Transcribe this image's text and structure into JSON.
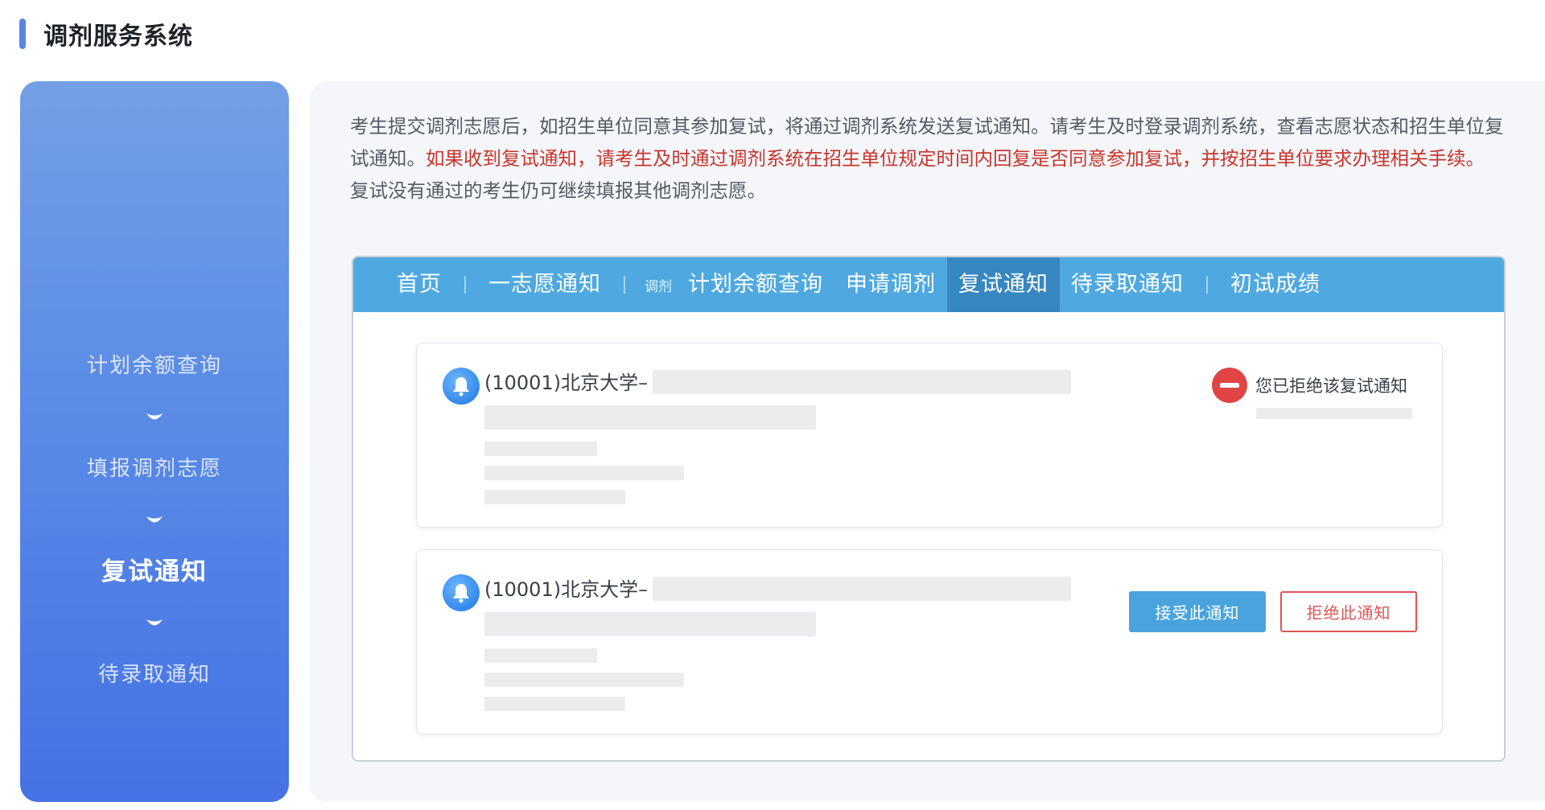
{
  "header": {
    "title": "调剂服务系统"
  },
  "sidebar": {
    "steps": [
      {
        "label": "计划余额查询",
        "active": false
      },
      {
        "label": "填报调剂志愿",
        "active": false
      },
      {
        "label": "复试通知",
        "active": true
      },
      {
        "label": "待录取通知",
        "active": false
      }
    ]
  },
  "intro": {
    "line1": "考生提交调剂志愿后，如招生单位同意其参加复试，将通过调剂系统发送复试通知。请考生及时登录调剂系统，查看志愿状态和招生单位复试通知。",
    "highlight": "如果收到复试通知，请考生及时通过调剂系统在招生单位规定时间内回复是否同意参加复试，并按招生单位要求办理相关手续。",
    "line2": "复试没有通过的考生仍可继续填报其他调剂志愿。"
  },
  "screenshot": {
    "nav": {
      "home": "首页",
      "first_choice": "一志愿通知",
      "adjust_small": "调剂",
      "quota": "计划余额查询",
      "apply": "申请调剂",
      "retest": "复试通知",
      "pending": "待录取通知",
      "scores": "初试成绩",
      "active": "复试通知"
    },
    "cards": [
      {
        "school": "(10001)北京大学–",
        "status_text": "您已拒绝该复试通知"
      },
      {
        "school": "(10001)北京大学–",
        "accept_label": "接受此通知",
        "reject_label": "拒绝此通知"
      }
    ]
  },
  "colors": {
    "sidebar_top": "#739fe4",
    "sidebar_bottom": "#4572e4",
    "nav_bar": "#4fa9e0",
    "nav_active": "#3787c0",
    "highlight_red": "#c8362c",
    "accept_button": "#4aa3dd",
    "reject_border": "#e05555"
  },
  "icons": [
    "bell-icon",
    "rejected-status-icon",
    "chevron-down-icon"
  ]
}
